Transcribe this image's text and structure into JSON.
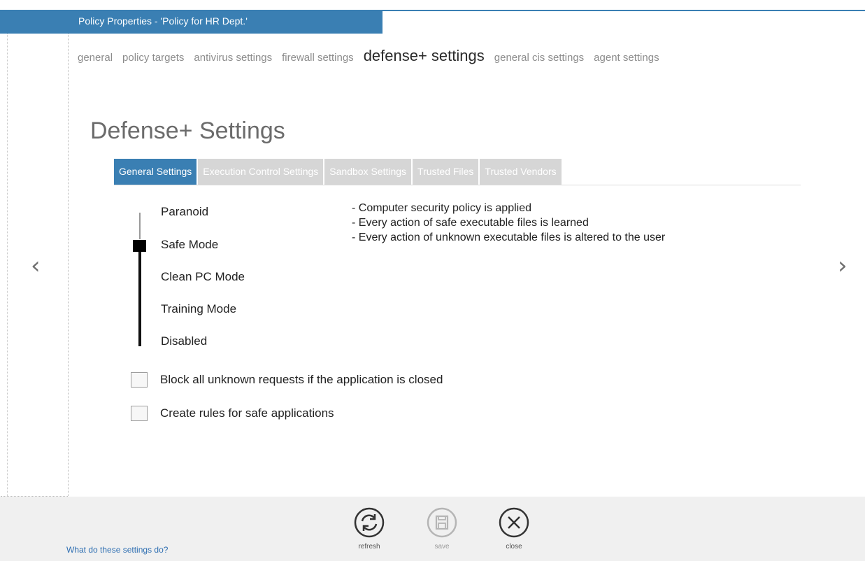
{
  "window": {
    "title": "Policy Properties - 'Policy for HR Dept.'"
  },
  "nav": {
    "tabs": [
      {
        "label": "general"
      },
      {
        "label": "policy targets"
      },
      {
        "label": "antivirus settings"
      },
      {
        "label": "firewall settings"
      },
      {
        "label": "defense+ settings"
      },
      {
        "label": "general cis settings"
      },
      {
        "label": "agent settings"
      }
    ],
    "active": "defense+ settings"
  },
  "page": {
    "title": "Defense+ Settings"
  },
  "sub_tabs": {
    "items": [
      {
        "label": "General Settings"
      },
      {
        "label": "Execution Control Settings"
      },
      {
        "label": "Sandbox Settings"
      },
      {
        "label": "Trusted Files"
      },
      {
        "label": "Trusted Vendors"
      }
    ],
    "active": "General Settings"
  },
  "security_level": {
    "levels": [
      "Paranoid",
      "Safe Mode",
      "Clean PC Mode",
      "Training Mode",
      "Disabled"
    ],
    "selected": "Safe Mode",
    "description": [
      "- Computer security policy is applied",
      "- Every action of safe executable files is learned",
      "- Every action of unknown executable files is altered to the user"
    ]
  },
  "options": {
    "block_unknown": {
      "label": "Block all unknown requests if the application is closed",
      "checked": false
    },
    "create_rules": {
      "label": "Create rules for safe applications",
      "checked": false
    }
  },
  "navigation": {
    "prev_icon": "chevron-left-icon",
    "next_icon": "chevron-right-icon"
  },
  "footer": {
    "help_link": "What do these settings do?",
    "actions": [
      {
        "label": "refresh",
        "icon": "refresh-icon",
        "enabled": true
      },
      {
        "label": "save",
        "icon": "save-icon",
        "enabled": false
      },
      {
        "label": "close",
        "icon": "close-icon",
        "enabled": true
      }
    ]
  },
  "colors": {
    "accent": "#3a7fb3",
    "inactive_tab": "#d6d6d6",
    "footer_bg": "#f0f0f0",
    "link": "#2f6fb2"
  }
}
